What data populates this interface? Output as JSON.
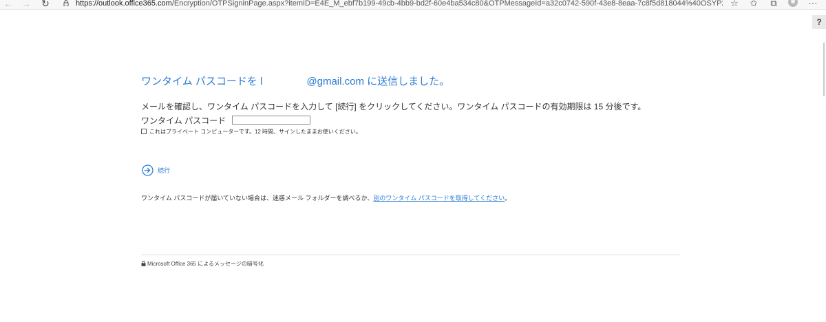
{
  "browser": {
    "url_domain": "https://outlook.office365.com",
    "url_path": "/Encryption/OTPSigninPage.aspx?itemID=E4E_M_ebf7b199-49cb-4bb9-bd2f-60e4ba534c80&OTPMessageId=a32c0742-590f-43e8-8eaa-7c8f5d818044%40OSYP286MB0391.JPNP28...",
    "back_icon": "←",
    "forward_icon": "→",
    "refresh_icon": "↻",
    "favorite_icon": "☆",
    "favorites_icon": "✩",
    "collections_icon": "⧉",
    "menu_icon": "···"
  },
  "help": {
    "label": "?"
  },
  "main": {
    "heading_prefix": "ワンタイム パスコードを ",
    "heading_marker": "l",
    "heading_email": "@gmail.com",
    "heading_suffix": " に送信しました。",
    "instruction": "メールを確認し、ワンタイム パスコードを入力して [続行] をクリックしてください。ワンタイム パスコードの有効期限は 15 分後です。",
    "passcode_label": "ワンタイム パスコード",
    "passcode_value": "",
    "private_label": "これはプライベート コンピューターです。12 時間、サインしたままお使いください。",
    "continue_label": "続行",
    "resend_text": "ワンタイム パスコードが届いていない場合は、迷惑メール フォルダーを調べるか、",
    "resend_link": "別のワンタイム パスコードを取得してください",
    "resend_end": "。"
  },
  "footer": {
    "text": "Microsoft Office 365 によるメッセージの暗号化"
  },
  "colors": {
    "accent": "#2b7cd3",
    "text": "#333333"
  }
}
